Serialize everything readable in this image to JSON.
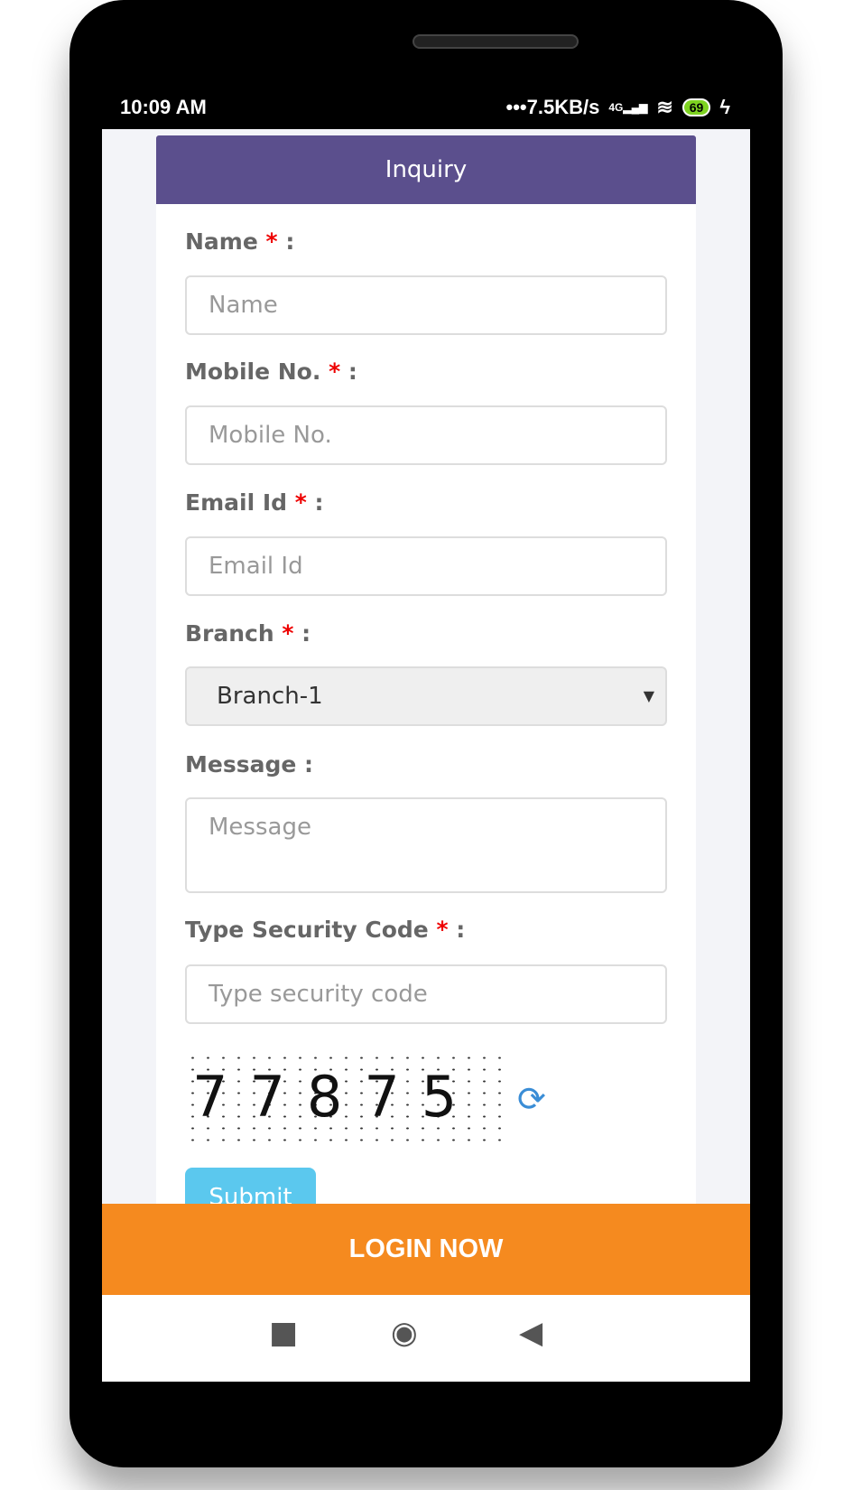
{
  "status_bar": {
    "time": "10:09 AM",
    "network_speed": "•••7.5KB/s",
    "network_type": "4G",
    "battery": "69"
  },
  "form": {
    "title": "Inquiry",
    "required_mark": "*",
    "fields": [
      {
        "label": "Name",
        "placeholder": "Name",
        "required": true
      },
      {
        "label": "Mobile No.",
        "placeholder": "Mobile No.",
        "required": true
      },
      {
        "label": "Email Id",
        "placeholder": "Email Id",
        "required": true
      },
      {
        "label": "Branch",
        "value": "Branch-1",
        "required": true
      },
      {
        "label": "Message",
        "placeholder": "Message",
        "required": false
      },
      {
        "label": "Type Security Code",
        "placeholder": "Type security code",
        "required": true
      }
    ],
    "captcha": "77875",
    "submit_label": "Submit"
  },
  "login_button": "LOGIN NOW",
  "colors": {
    "header": "#5b4f8d",
    "login": "#f58a1f",
    "submit": "#5bc8ee",
    "required": "#ee0000"
  }
}
